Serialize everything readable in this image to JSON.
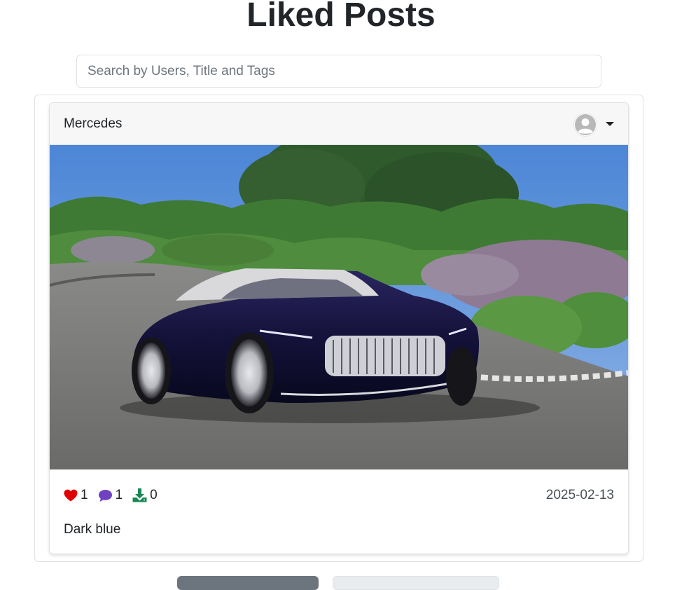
{
  "page": {
    "title": "Liked Posts"
  },
  "search": {
    "placeholder": "Search by Users, Title and Tags",
    "value": ""
  },
  "post": {
    "author": "Mercedes",
    "image_alt": "Dark blue Mercedes-Maybach concept convertible parked on a curved road with shrubs and trees",
    "stats": {
      "likes": "1",
      "comments": "1",
      "downloads": "0"
    },
    "date": "2025-02-13",
    "caption": "Dark blue"
  },
  "icons": {
    "like": "heart-icon",
    "comment": "comment-icon",
    "download": "download-icon",
    "avatar": "user-avatar-icon",
    "menu": "caret-down-icon"
  },
  "colors": {
    "like": "#e00000",
    "comment": "#6f42c1",
    "download": "#198754",
    "text": "#212529",
    "muted": "#6c757d"
  }
}
